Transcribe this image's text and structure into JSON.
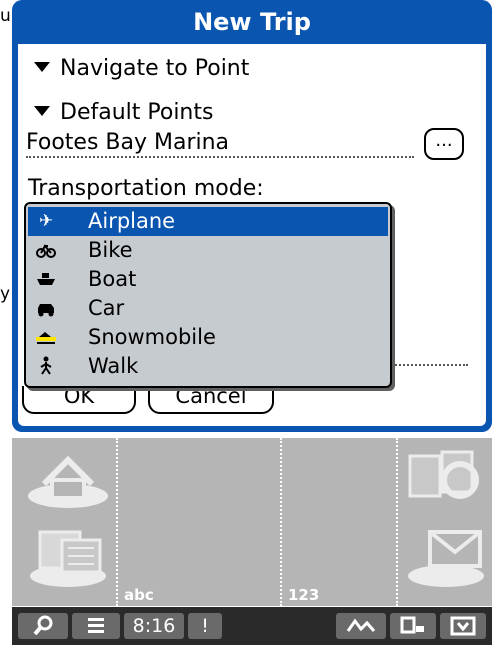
{
  "left_fragments": [
    "u",
    "y"
  ],
  "dialog": {
    "title": "New Trip",
    "navigate_label": "Navigate to Point",
    "default_points_label": "Default Points",
    "location_value": "Footes Bay Marina",
    "ellipsis_label": "...",
    "transport_label": "Transportation mode:",
    "ok_label": "OK",
    "cancel_label": "Cancel",
    "colors": {
      "accent": "#0a55b0",
      "list_bg": "#c6cbd0"
    }
  },
  "transport_list": {
    "selected": "Airplane",
    "items": [
      {
        "label": "Airplane",
        "icon": "airplane-icon"
      },
      {
        "label": "Bike",
        "icon": "bike-icon"
      },
      {
        "label": "Boat",
        "icon": "boat-icon"
      },
      {
        "label": "Car",
        "icon": "car-icon"
      },
      {
        "label": "Snowmobile",
        "icon": "snowmobile-icon"
      },
      {
        "label": "Walk",
        "icon": "walk-icon"
      }
    ]
  },
  "graffiti": {
    "abc_label": "abc",
    "num_label": "123",
    "icons": [
      "home-icon",
      "calculator-icon",
      "find-icon",
      "mail-icon"
    ]
  },
  "status_bar": {
    "time": "8:16",
    "icons": [
      "search-icon",
      "menu-icon",
      "alert-icon",
      "signal-icon",
      "keyboard-icon",
      "dock-icon"
    ]
  }
}
